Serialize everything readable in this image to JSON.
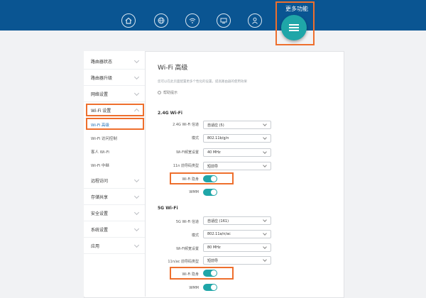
{
  "more_features": {
    "label": "更多功能"
  },
  "nav_icons": [
    "home-icon",
    "globe-icon",
    "wifi-icon",
    "devices-icon",
    "user-icon"
  ],
  "sidebar": {
    "items": [
      {
        "label": "路由器状态"
      },
      {
        "label": "路由器升级"
      },
      {
        "label": "网络设置"
      },
      {
        "label": "Wi-Fi 设置"
      },
      {
        "label": "远程访问"
      },
      {
        "label": "存储共享"
      },
      {
        "label": "安全设置"
      },
      {
        "label": "系统设置"
      },
      {
        "label": "应用"
      }
    ],
    "subitems": [
      {
        "label": "Wi-Fi 高级"
      },
      {
        "label": "Wi-Fi 访问控制"
      },
      {
        "label": "客人 Wi-Fi"
      },
      {
        "label": "Wi-Fi 中继"
      }
    ]
  },
  "content": {
    "title": "Wi-Fi 高级",
    "description": "您可以在此页面配置更多个性化的设置，提高路由器的使用效果",
    "help": "帮助提示",
    "wifi24": {
      "title": "2.4G Wi-Fi",
      "rows": [
        {
          "label": "2.4G Wi-Fi 信道",
          "value": "自适应 (5)"
        },
        {
          "label": "模式",
          "value": "802.11b/g/n"
        },
        {
          "label": "Wi-Fi频宽设置",
          "value": "40 MHz"
        },
        {
          "label": "11n 前导码类型",
          "value": "短前导"
        }
      ],
      "hide_label": "Wi-Fi 隐身",
      "wmm_label": "WMM"
    },
    "wifi5": {
      "title": "5G Wi-Fi",
      "rows": [
        {
          "label": "5G Wi-Fi 信道",
          "value": "自适应 (161)"
        },
        {
          "label": "模式",
          "value": "802.11a/n/ac"
        },
        {
          "label": "Wi-Fi频宽设置",
          "value": "80 MHz"
        },
        {
          "label": "11n/ac 前导码类型",
          "value": "短前导"
        }
      ],
      "hide_label": "Wi-Fi 隐身",
      "wmm_label": "WMM"
    }
  },
  "colors": {
    "header": "#0a5592",
    "accent": "#1fa6a8",
    "highlight": "#ee6f2d"
  }
}
